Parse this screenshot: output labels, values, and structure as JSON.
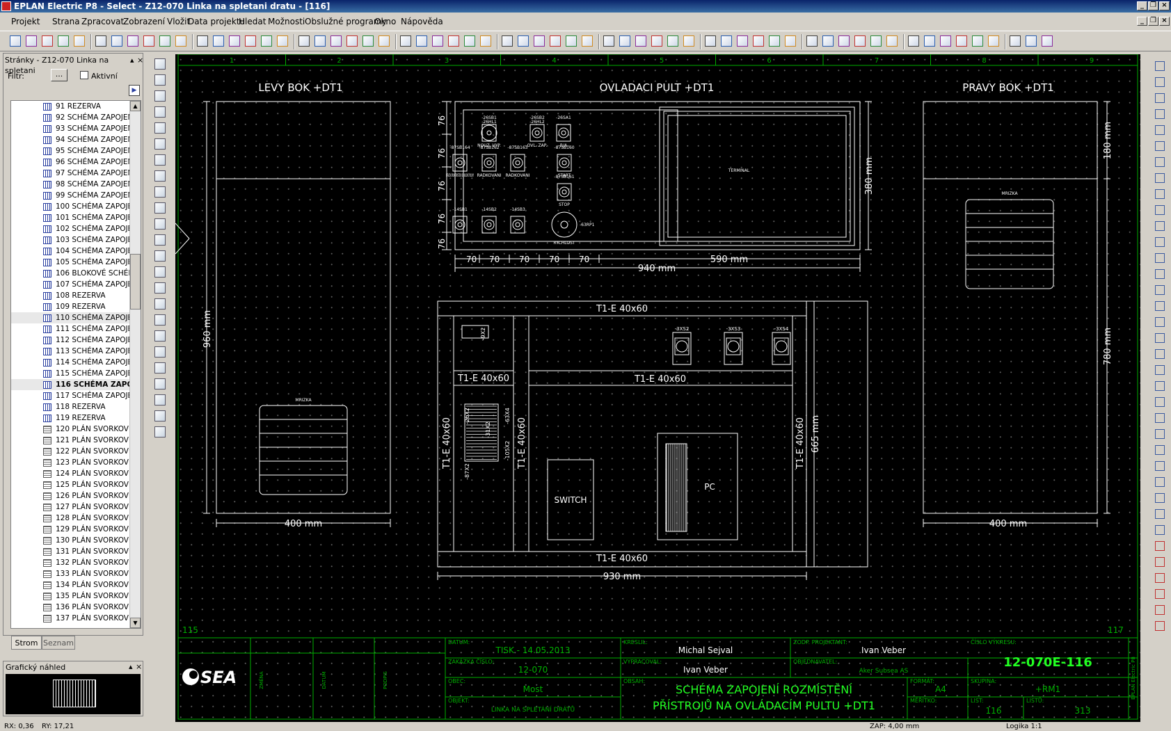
{
  "window": {
    "title": "EPLAN Electric P8 - Select - Z12-070 Linka na spletani dratu - [116]"
  },
  "menu": [
    "Projekt",
    "Strana",
    "Zpracovat",
    "Zobrazení",
    "Vložit",
    "Data projektu",
    "Hledat",
    "Možnosti",
    "Obslužné programy",
    "Okno",
    "Nápověda"
  ],
  "sidebar": {
    "title": "Stránky - Z12-070 Linka na spletani",
    "filter_label": "Filtr:",
    "filter_button": "...",
    "active_label": "Aktivní",
    "items": [
      {
        "label": "91 REZERVA",
        "icon": "schematic"
      },
      {
        "label": "92 SCHÉMA ZAPOJENÍ",
        "icon": "schematic"
      },
      {
        "label": "93 SCHÉMA ZAPOJENÍ",
        "icon": "schematic"
      },
      {
        "label": "94 SCHÉMA ZAPOJENÍ",
        "icon": "schematic"
      },
      {
        "label": "95 SCHÉMA ZAPOJENÍ",
        "icon": "schematic"
      },
      {
        "label": "96 SCHÉMA ZAPOJENÍ",
        "icon": "schematic"
      },
      {
        "label": "97 SCHÉMA ZAPOJENÍ",
        "icon": "schematic"
      },
      {
        "label": "98 SCHÉMA ZAPOJENÍ",
        "icon": "schematic"
      },
      {
        "label": "99 SCHÉMA ZAPOJENÍ",
        "icon": "schematic"
      },
      {
        "label": "100 SCHÉMA ZAPOJEN",
        "icon": "schematic"
      },
      {
        "label": "101 SCHÉMA ZAPOJEN",
        "icon": "schematic"
      },
      {
        "label": "102 SCHÉMA ZAPOJEN",
        "icon": "schematic"
      },
      {
        "label": "103 SCHÉMA ZAPOJEN",
        "icon": "schematic"
      },
      {
        "label": "104 SCHÉMA ZAPOJEN",
        "icon": "schematic"
      },
      {
        "label": "105 SCHÉMA ZAPOJEN",
        "icon": "schematic"
      },
      {
        "label": "106 BLOKOVÉ SCHÉMA",
        "icon": "schematic"
      },
      {
        "label": "107 SCHÉMA ZAPOJEN",
        "icon": "schematic"
      },
      {
        "label": "108 REZERVA",
        "icon": "schematic"
      },
      {
        "label": "109 REZERVA",
        "icon": "schematic"
      },
      {
        "label": "110 SCHÉMA ZAPOJEN",
        "icon": "schematic"
      },
      {
        "label": "111 SCHÉMA ZAPOJEN",
        "icon": "schematic"
      },
      {
        "label": "112 SCHÉMA ZAPOJEN",
        "icon": "schematic"
      },
      {
        "label": "113 SCHÉMA ZAPOJEN",
        "icon": "schematic"
      },
      {
        "label": "114 SCHÉMA ZAPOJEN",
        "icon": "schematic"
      },
      {
        "label": "115 SCHÉMA ZAPOJEN",
        "icon": "schematic"
      },
      {
        "label": "116 SCHÉMA ZAPO",
        "icon": "schematic",
        "bold": true
      },
      {
        "label": "117 SCHÉMA ZAPOJEN",
        "icon": "schematic"
      },
      {
        "label": "118 REZERVA",
        "icon": "schematic"
      },
      {
        "label": "119 REZERVA",
        "icon": "schematic"
      },
      {
        "label": "120 PLÁN SVORKOVNI",
        "icon": "plan"
      },
      {
        "label": "121 PLÁN SVORKOVNI",
        "icon": "plan"
      },
      {
        "label": "122 PLÁN SVORKOVNI",
        "icon": "plan"
      },
      {
        "label": "123 PLÁN SVORKOVNI",
        "icon": "plan"
      },
      {
        "label": "124 PLÁN SVORKOVNI",
        "icon": "plan"
      },
      {
        "label": "125 PLÁN SVORKOVNI",
        "icon": "plan"
      },
      {
        "label": "126 PLÁN SVORKOVNI",
        "icon": "plan"
      },
      {
        "label": "127 PLÁN SVORKOVNI",
        "icon": "plan"
      },
      {
        "label": "128 PLÁN SVORKOVNI",
        "icon": "plan"
      },
      {
        "label": "129 PLÁN SVORKOVNI",
        "icon": "plan"
      },
      {
        "label": "130 PLÁN SVORKOVNI",
        "icon": "plan"
      },
      {
        "label": "131 PLÁN SVORKOVNI",
        "icon": "plan"
      },
      {
        "label": "132 PLÁN SVORKOVNI",
        "icon": "plan"
      },
      {
        "label": "133 PLÁN SVORKOVNI",
        "icon": "plan"
      },
      {
        "label": "134 PLÁN SVORKOVNI",
        "icon": "plan"
      },
      {
        "label": "135 PLÁN SVORKOVNI",
        "icon": "plan"
      },
      {
        "label": "136 PLÁN SVORKOVNI",
        "icon": "plan"
      },
      {
        "label": "137 PLÁN SVORKOVNI",
        "icon": "plan"
      }
    ],
    "tabs": [
      "Strom",
      "Seznam"
    ],
    "preview_title": "Grafický náhled"
  },
  "drawing": {
    "columns": [
      "1",
      "2",
      "3",
      "4",
      "5",
      "6",
      "7",
      "8",
      "9"
    ],
    "prev_page": "115",
    "next_page": "117",
    "left_side": {
      "title": "LEVY BOK +DT1",
      "height": "960 mm",
      "width": "400 mm",
      "grille": "MRIZKA"
    },
    "right_side": {
      "title": "PRAVY BOK +DT1",
      "top_dim": "180 mm",
      "bottom_dim": "780 mm",
      "width": "400 mm",
      "grille": "MRIZKA"
    },
    "panel": {
      "title": "OVLADACI PULT +DT1",
      "row_dims": [
        "76",
        "76",
        "76",
        "76",
        "76"
      ],
      "col_dims": [
        "70",
        "70",
        "70",
        "70",
        "70"
      ],
      "right_width": "590 mm",
      "total_width": "940 mm",
      "height": "380 mm",
      "terminal": "TERMINAL",
      "devices": [
        {
          "tag": "-26SB1",
          "tag2": "-26HL1",
          "label": "NOUZ. VYP."
        },
        {
          "tag": "-26SB2",
          "tag2": "-26HL2",
          "label": "OVL. ZAP."
        },
        {
          "tag": "-26SA1",
          "tag2": "",
          "label": "R/A"
        },
        {
          "tag": "-87SB164",
          "tag2": "",
          "label": "OTACENI DRUM TWISTERU DO NULOVE POLOHY"
        },
        {
          "tag": "-87SB162",
          "tag2": "",
          "label": "RADKOVANI"
        },
        {
          "tag": "-87SB163",
          "tag2": "",
          "label": "RADKOVANI"
        },
        {
          "tag": "-87SB160",
          "tag2": "",
          "label": "START"
        },
        {
          "tag": "-87SB161",
          "tag2": "",
          "label": "STOP"
        },
        {
          "tag": "-14SB1",
          "tag2": "",
          "label": ""
        },
        {
          "tag": "-14SB2",
          "tag2": "",
          "label": ""
        },
        {
          "tag": "-14SB3",
          "tag2": "",
          "label": ""
        },
        {
          "tag": "-63RP1",
          "tag2": "",
          "label": "RYCHLOST"
        }
      ]
    },
    "cabinet": {
      "duct": "T1-E 40x60",
      "width": "930 mm",
      "height": "665 mm",
      "terminal_block": "-9X2",
      "sockets": [
        "-3XS2",
        "-3XS3",
        "-3XS4"
      ],
      "terminals": [
        "-26X2",
        "-31X2",
        "-63X4",
        "-87X2",
        "-105X2"
      ],
      "switch": "SWITCH",
      "pc": "PC"
    },
    "title_block": {
      "logo": "SEA",
      "rev_cols": [
        "ZMĚNA",
        "DATUM",
        "PODPIS"
      ],
      "date_label": "DATUM:",
      "date": "TISK - 14.05.2013",
      "order_label": "ZAKÁZKA ČÍSLO:",
      "order": "12-070",
      "municipality_label": "OBEC:",
      "municipality": "Most",
      "object_label": "OBJEKT:",
      "object": "LINKA NA SPLETÁNÍ DRÁTŮ",
      "drew_label": "KRESLIL:",
      "drew": "Michal Sejval",
      "worked_label": "VYPRACOVAL:",
      "worked": "Ivan Veber",
      "content_label": "OBSAH:",
      "content1": "SCHÉMA ZAPOJENÍ ROZMÍSTĚNÍ",
      "content2": "PŘÍSTROJŮ NA OVLÁDACÍM PULTU +DT1",
      "resp_label": "ZODP. PROJEKTANT:",
      "resp": "Ivan Veber",
      "customer_label": "OBJEDNAVATEL:",
      "customer": "Aker Subsea AS",
      "format_label": "FORMÁT:",
      "format": "A4",
      "scale_label": "MĚŘÍTKO:",
      "dwg_label": "ČÍSLO VÝKRESU:",
      "dwg": "12-070E-116",
      "group_label": "SKUPINA:",
      "group": "+RM1",
      "sheet_label": "LIST:",
      "sheet": "116",
      "sheets_label": "LISTŮ:",
      "sheets": "313",
      "vendor": "EPLAN Electric P8"
    }
  },
  "status": {
    "rx": "RX: 0,36",
    "ry": "RY: 17,21",
    "zap": "ZAP: 4,00 mm",
    "logic": "Logika 1:1"
  },
  "colors": {
    "accent": "#00b000",
    "line": "#ffffff",
    "canvas": "#000000",
    "title_text": "#22ff22"
  }
}
